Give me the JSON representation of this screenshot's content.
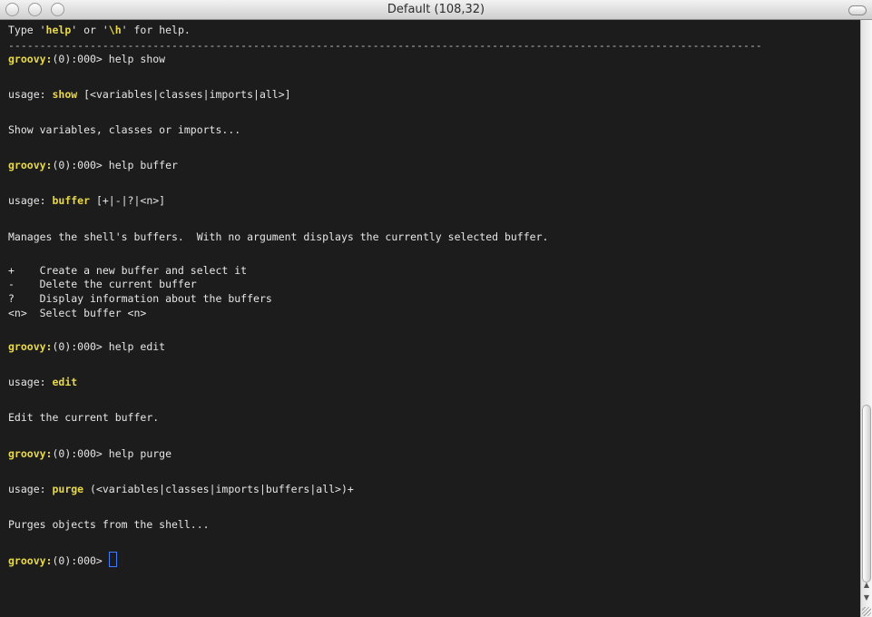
{
  "window": {
    "title": "Default (108,32)"
  },
  "terminal": {
    "intro": {
      "pre": "Type '",
      "help": "help",
      "mid": "' or '",
      "h": "\\h",
      "post": "' for help."
    },
    "separator": "------------------------------------------------------------------------------------------------------------------------",
    "prompt": "groovy:",
    "prompt_rest": "(0):000>",
    "cmd1": " help show",
    "usage_label": "usage: ",
    "show_cmd": "show",
    "show_args": " [<variables|classes|imports|all>]",
    "show_desc": "Show variables, classes or imports...",
    "cmd2": " help buffer",
    "buffer_cmd": "buffer",
    "buffer_args": " [+|-|?|<n>]",
    "buffer_desc": "Manages the shell's buffers.  With no argument displays the currently selected buffer.",
    "buffer_opts": [
      "+    Create a new buffer and select it",
      "-    Delete the current buffer",
      "?    Display information about the buffers",
      "<n>  Select buffer <n>"
    ],
    "cmd3": " help edit",
    "edit_cmd": "edit",
    "edit_desc": "Edit the current buffer.",
    "cmd4": " help purge",
    "purge_cmd": "purge",
    "purge_args": " (<variables|classes|imports|buffers|all>)+",
    "purge_desc": "Purges objects from the shell..."
  },
  "colors": {
    "background": "#1c1c1c",
    "foreground": "#e6e6e6",
    "highlight": "#e8d84a",
    "cursor": "#3f7cff"
  },
  "icons": [
    "close-button-icon",
    "minimize-button-icon",
    "zoom-button-icon",
    "toolbar-toggle-icon",
    "scroll-up-arrow-icon",
    "scroll-down-arrow-icon",
    "resize-grip-icon"
  ]
}
